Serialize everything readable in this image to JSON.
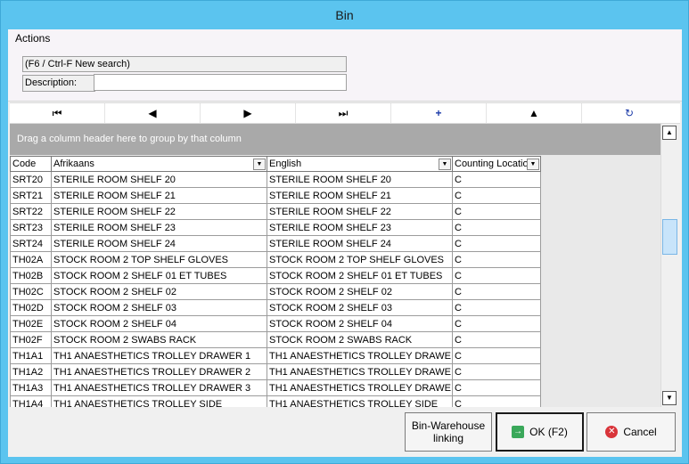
{
  "window": {
    "title": "Bin"
  },
  "actions": {
    "label": "Actions",
    "search_hint": "(F6 / Ctrl-F New search)",
    "description_label": "Description:",
    "description_value": ""
  },
  "nav": {
    "first": "⏮",
    "prev": "◀",
    "next": "▶",
    "last": "⏭",
    "add": "+",
    "up": "▲",
    "refresh": "↻"
  },
  "grid": {
    "group_hint": "Drag a column header here to group by that column",
    "columns": [
      "Code",
      "Afrikaans",
      "English",
      "Counting Locatio"
    ],
    "rows": [
      [
        "SRT20",
        "STERILE ROOM SHELF 20",
        "STERILE ROOM SHELF 20",
        "C"
      ],
      [
        "SRT21",
        "STERILE ROOM SHELF 21",
        "STERILE ROOM SHELF 21",
        "C"
      ],
      [
        "SRT22",
        "STERILE ROOM SHELF 22",
        "STERILE ROOM SHELF 22",
        "C"
      ],
      [
        "SRT23",
        "STERILE ROOM SHELF 23",
        "STERILE ROOM SHELF 23",
        "C"
      ],
      [
        "SRT24",
        "STERILE ROOM SHELF 24",
        "STERILE ROOM SHELF 24",
        "C"
      ],
      [
        "TH02A",
        "STOCK ROOM 2 TOP SHELF GLOVES",
        "STOCK ROOM 2 TOP SHELF GLOVES",
        "C"
      ],
      [
        "TH02B",
        "STOCK ROOM 2 SHELF 01 ET TUBES",
        "STOCK ROOM 2 SHELF 01 ET TUBES",
        "C"
      ],
      [
        "TH02C",
        "STOCK ROOM 2 SHELF 02",
        "STOCK ROOM 2 SHELF 02",
        "C"
      ],
      [
        "TH02D",
        "STOCK ROOM 2 SHELF 03",
        "STOCK ROOM 2 SHELF 03",
        "C"
      ],
      [
        "TH02E",
        "STOCK ROOM 2 SHELF 04",
        "STOCK ROOM 2 SHELF 04",
        "C"
      ],
      [
        "TH02F",
        "STOCK ROOM 2 SWABS RACK",
        "STOCK ROOM 2 SWABS RACK",
        "C"
      ],
      [
        "TH1A1",
        "TH1 ANAESTHETICS TROLLEY DRAWER 1",
        "TH1 ANAESTHETICS TROLLEY DRAWE",
        "C"
      ],
      [
        "TH1A2",
        "TH1 ANAESTHETICS TROLLEY DRAWER 2",
        "TH1 ANAESTHETICS TROLLEY DRAWE",
        "C"
      ],
      [
        "TH1A3",
        "TH1 ANAESTHETICS TROLLEY DRAWER 3",
        "TH1 ANAESTHETICS TROLLEY DRAWE",
        "C"
      ],
      [
        "TH1A4",
        "TH1 ANAESTHETICS TROLLEY SIDE",
        "TH1 ANAESTHETICS TROLLEY SIDE",
        "C"
      ]
    ]
  },
  "scrollbar": {
    "up": "▲",
    "down": "▼"
  },
  "buttons": {
    "bin_warehouse": "Bin-Warehouse linking",
    "ok": "OK (F2)",
    "ok_icon": "→",
    "cancel": "Cancel",
    "cancel_icon": "✕"
  },
  "colors": {
    "titlebar": "#5bc4ef",
    "group_panel": "#a9a9a9",
    "scroll_thumb": "#c8e4fa"
  }
}
